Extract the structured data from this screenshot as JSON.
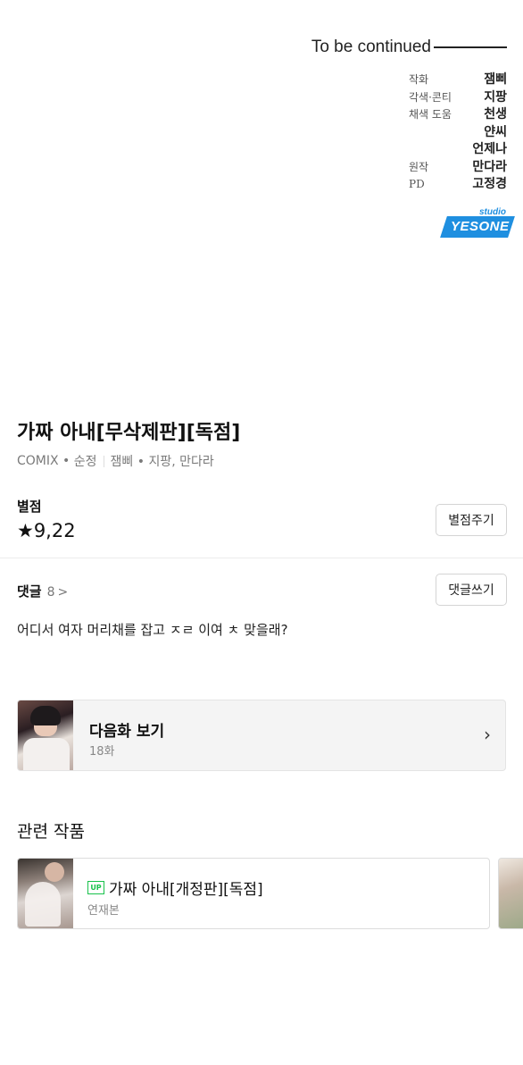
{
  "viewer": {
    "to_be_continued": "To be continued",
    "credits": [
      {
        "role": "작화",
        "name": "잼삐"
      },
      {
        "role": "각색·콘티",
        "name": "지팡"
      },
      {
        "role": "채색 도움",
        "name": "천생"
      },
      {
        "role": "",
        "name": "얀씨"
      },
      {
        "role": "",
        "name": "언제나"
      },
      {
        "role": "원작",
        "name": "만다라"
      },
      {
        "role": "PD",
        "name": "고정경"
      }
    ],
    "studio_small": "studio",
    "studio_big": "YESONE",
    "logo_color": "#1f8fe0"
  },
  "work": {
    "title": "가짜 아내[무삭제판][독점]",
    "platform": "COMIX",
    "genre": "순정",
    "authors": "잼삐 • 지팡, 만다라"
  },
  "rating": {
    "label": "별점",
    "value": "★9,22",
    "button": "별점주기"
  },
  "comments": {
    "label": "댓글",
    "count": "8",
    "chevron": ">",
    "button": "댓글쓰기",
    "top_comment": "어디서 여자 머리채를 잡고 ㅈㄹ 이여 ㅊ 맞을래?"
  },
  "next_episode": {
    "title": "다음화 보기",
    "episode": "18화",
    "chevron": "›"
  },
  "related": {
    "heading": "관련 작품",
    "items": [
      {
        "badge": "UP",
        "title": "가짜 아내[개정판][독점]",
        "subtitle": "연재본"
      }
    ],
    "badge_color": "#18c24b"
  }
}
